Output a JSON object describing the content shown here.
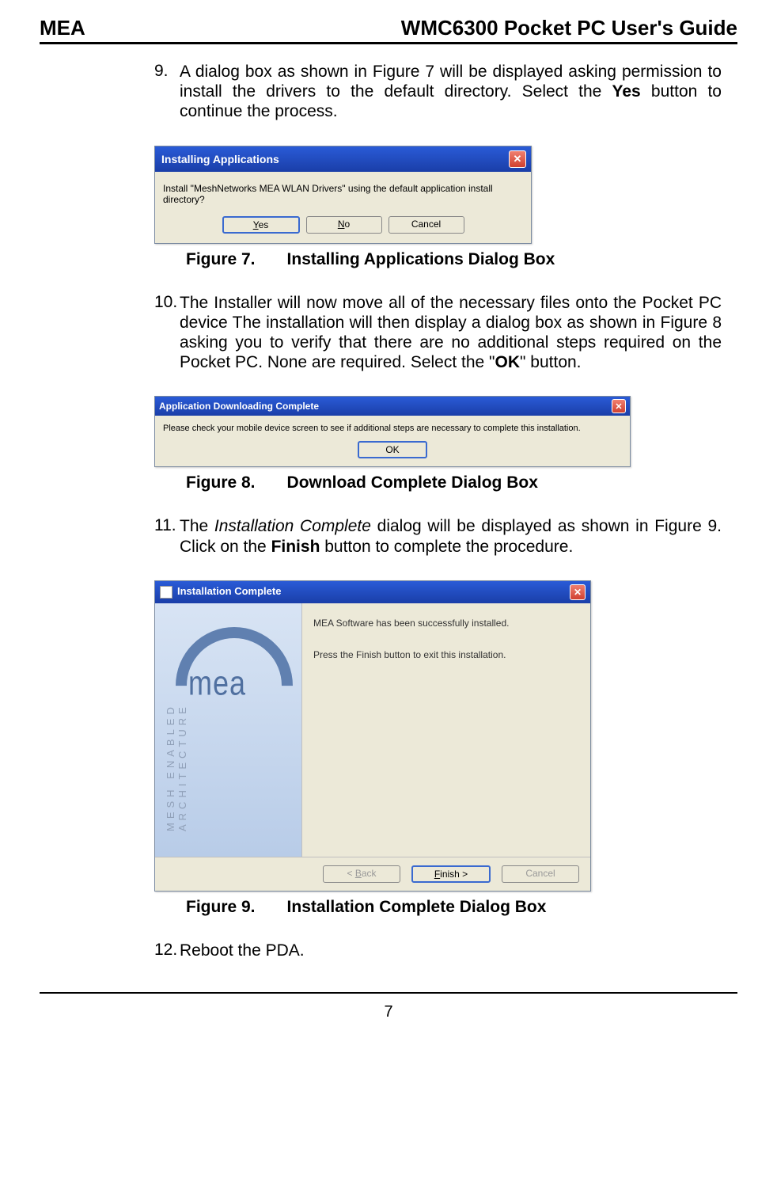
{
  "header": {
    "left": "MEA",
    "right": "WMC6300 Pocket PC User's Guide"
  },
  "steps": {
    "s9": {
      "num": "9.",
      "t1": "A dialog box as shown in ",
      "fig": "Figure 7",
      "t2": " will be displayed asking permission to install the drivers to the default directory.  Select the ",
      "bold": "Yes",
      "t3": " button to continue the process."
    },
    "s10": {
      "num": "10.",
      "t1": "The Installer will now move all of the necessary files onto the Pocket PC device The installation will then display a dialog box as shown in ",
      "fig": "Figure 8",
      "t2": " asking you to verify that there are no additional steps required on the Pocket PC.  None are required.  Select the \"",
      "bold": "OK",
      "t3": "\" button."
    },
    "s11": {
      "num": "11.",
      "t1": "The ",
      "italic": "Installation Complete",
      "t2": " dialog will be displayed as shown in ",
      "fig": "Figure 9",
      "t3": ". Click on the ",
      "bold": "Finish",
      "t4": " button to complete the procedure."
    },
    "s12": {
      "num": "12.",
      "t1": "Reboot the PDA."
    }
  },
  "captions": {
    "fig7": {
      "label": "Figure 7.",
      "text": "Installing Applications Dialog Box"
    },
    "fig8": {
      "label": "Figure 8.",
      "text": "Download Complete Dialog Box"
    },
    "fig9": {
      "label": "Figure 9.",
      "text": "Installation Complete Dialog Box"
    }
  },
  "dialog1": {
    "title": "Installing Applications",
    "message": "Install \"MeshNetworks MEA WLAN Drivers\" using the default application install directory?",
    "yes_pre": "",
    "yes_u": "Y",
    "yes_post": "es",
    "no_pre": "",
    "no_u": "N",
    "no_post": "o",
    "cancel": "Cancel"
  },
  "dialog2": {
    "title": "Application Downloading Complete",
    "message": "Please check your mobile device screen to see if additional steps are necessary to complete this installation.",
    "ok": "OK"
  },
  "dialog3": {
    "title": "Installation Complete",
    "line1": "MEA Software has been successfully installed.",
    "line2": "Press the Finish button to exit this installation.",
    "logo_big": "mea",
    "logo_side": "MESH ENABLED ARCHITECTURE",
    "back_pre": "< ",
    "back_u": "B",
    "back_post": "ack",
    "finish_u": "F",
    "finish_post": "inish >",
    "cancel": "Cancel"
  },
  "page_number": "7"
}
